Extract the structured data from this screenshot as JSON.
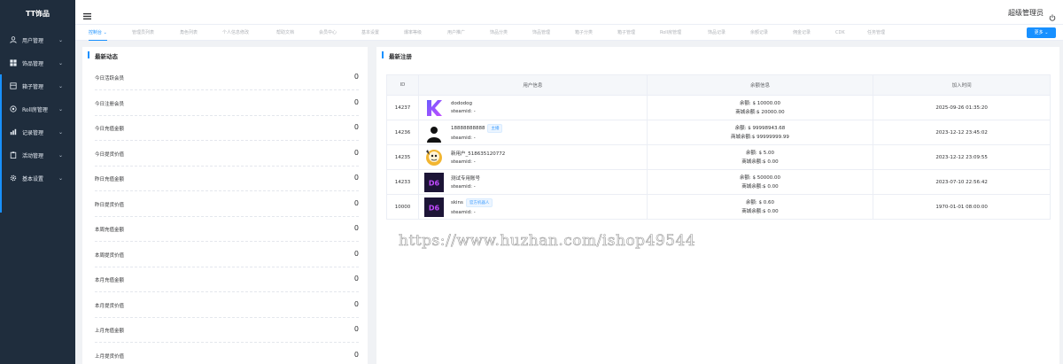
{
  "sidebar": {
    "brand": "TT饰品",
    "items": [
      {
        "label": "用户管理",
        "icon": "user-icon"
      },
      {
        "label": "饰品管理",
        "icon": "grid-icon"
      },
      {
        "label": "箱子管理",
        "icon": "box-icon"
      },
      {
        "label": "Roll房管理",
        "icon": "roll-icon"
      },
      {
        "label": "记录管理",
        "icon": "chart-icon"
      },
      {
        "label": "活动管理",
        "icon": "clipboard-icon"
      },
      {
        "label": "基本设置",
        "icon": "gear-icon"
      }
    ]
  },
  "header": {
    "admin_name": "超级管理员"
  },
  "tabs": [
    {
      "label": "控制台",
      "active": true
    },
    {
      "label": "管理员列表"
    },
    {
      "label": "角色列表"
    },
    {
      "label": "个人信息修改"
    },
    {
      "label": "帮助文档"
    },
    {
      "label": "会员中心"
    },
    {
      "label": "基本设置"
    },
    {
      "label": "爆率等级"
    },
    {
      "label": "用户推广"
    },
    {
      "label": "饰品分类"
    },
    {
      "label": "饰品管理"
    },
    {
      "label": "箱子分类"
    },
    {
      "label": "箱子管理"
    },
    {
      "label": "Roll房管理"
    },
    {
      "label": "饰品记录"
    },
    {
      "label": "余额记录"
    },
    {
      "label": "佣金记录"
    },
    {
      "label": "CDK"
    },
    {
      "label": "任务管理"
    }
  ],
  "more_button": "更多",
  "recent_activity": {
    "title": "最新动态",
    "stats": [
      {
        "label": "今日活跃会员",
        "value": "0"
      },
      {
        "label": "今日注册会员",
        "value": "0"
      },
      {
        "label": "今日充值金额",
        "value": "0"
      },
      {
        "label": "今日提货价值",
        "value": "0"
      },
      {
        "label": "昨日充值金额",
        "value": "0"
      },
      {
        "label": "昨日提货价值",
        "value": "0"
      },
      {
        "label": "本周充值金额",
        "value": "0"
      },
      {
        "label": "本周提货价值",
        "value": "0"
      },
      {
        "label": "本月充值金额",
        "value": "0"
      },
      {
        "label": "本月提货价值",
        "value": "0"
      },
      {
        "label": "上月充值金额",
        "value": "0"
      },
      {
        "label": "上月提货价值",
        "value": "0"
      }
    ]
  },
  "recent_registrations": {
    "title": "最新注册",
    "columns": [
      "ID",
      "用户信息",
      "余额信息",
      "加入时间"
    ],
    "rows": [
      {
        "id": "14237",
        "name": "dododog",
        "steamid": "steamid: -",
        "badge": "",
        "avatar": "k-logo",
        "balance": "余额: $ 10000.00",
        "mall_balance": "商城余额:$ 20000.00",
        "joined": "2025-09-26 01:35:20"
      },
      {
        "id": "14236",
        "name": "18888888888",
        "steamid": "steamid: -",
        "badge": "主播",
        "avatar": "silhouette",
        "balance": "余额: $ 99998943.68",
        "mall_balance": "商城余额:$ 99999999.99",
        "joined": "2023-12-12 23:45:02"
      },
      {
        "id": "14235",
        "name": "新用户_518635120772",
        "steamid": "steamid: -",
        "badge": "",
        "avatar": "cartoon",
        "balance": "余额: $ 5.00",
        "mall_balance": "商城余额:$ 0.00",
        "joined": "2023-12-12 23:09:55"
      },
      {
        "id": "14233",
        "name": "测试专用账号",
        "steamid": "steamid: -",
        "badge": "",
        "avatar": "d6-logo",
        "balance": "余额: $ 50000.00",
        "mall_balance": "商城余额:$ 0.00",
        "joined": "2023-07-10 22:56:42"
      },
      {
        "id": "10000",
        "name": "skins",
        "steamid": "steamid: -",
        "badge": "官方机器人",
        "avatar": "d6-logo",
        "balance": "余额: $ 0.60",
        "mall_balance": "商城余额:$ 0.00",
        "joined": "1970-01-01 08:00:00"
      }
    ]
  },
  "watermark": "https://www.huzhan.com/ishop49544",
  "colors": {
    "accent": "#1890ff",
    "sidebar_bg": "#1f2d3d"
  }
}
